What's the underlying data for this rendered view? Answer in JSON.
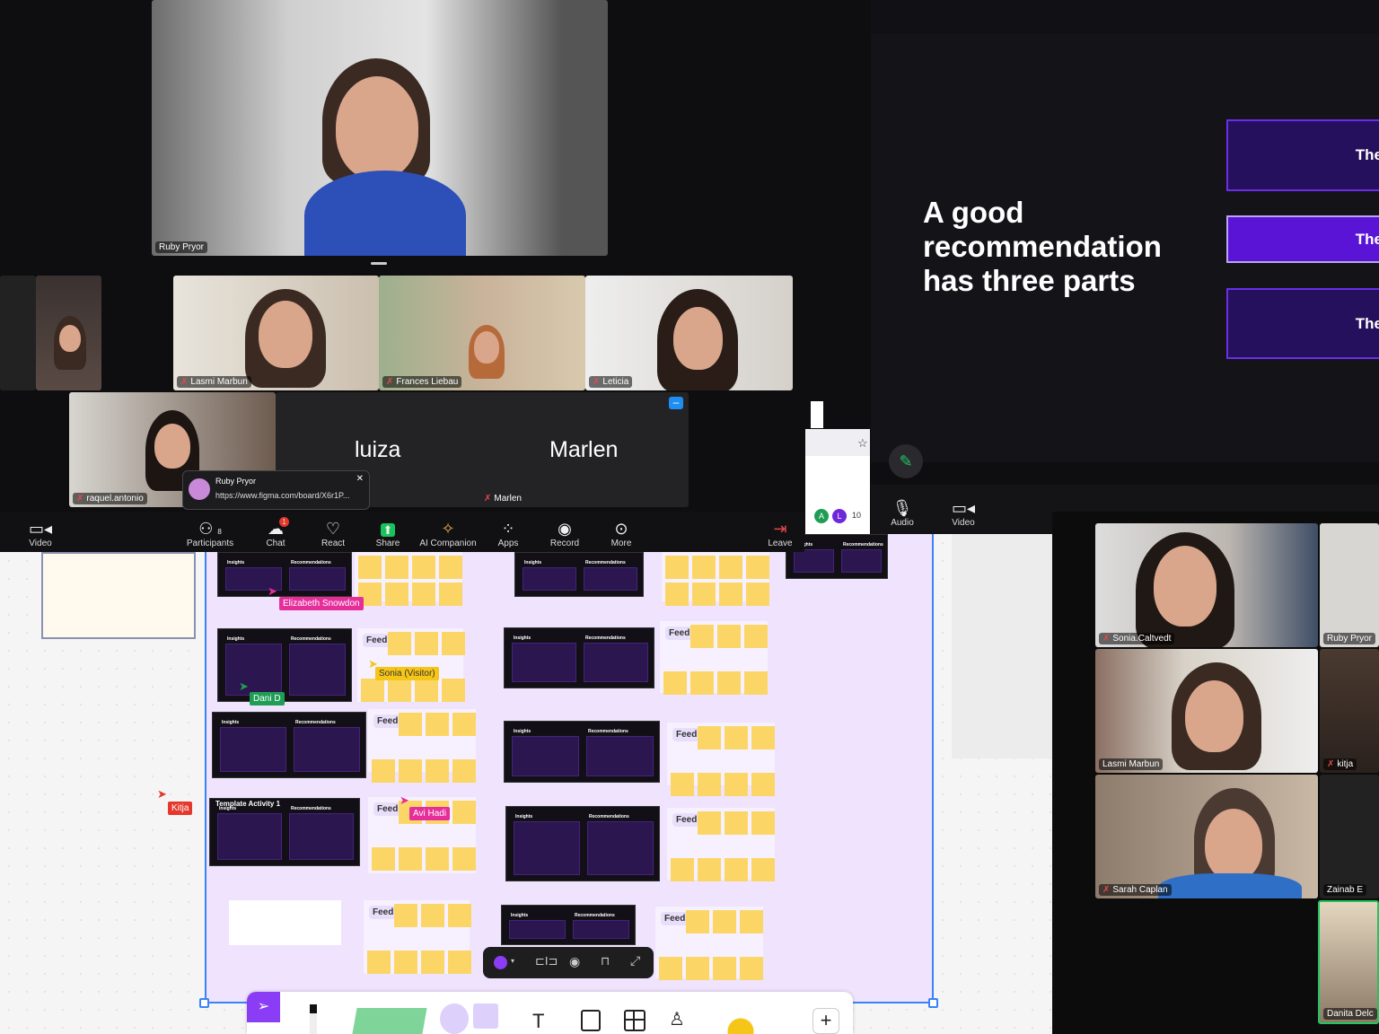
{
  "main_video": {
    "name": "Ruby Pryor"
  },
  "strip": [
    {
      "name": ""
    },
    {
      "name": "Lasmi Marbun"
    },
    {
      "name": "Frances Liebau"
    },
    {
      "name": "Leticia"
    }
  ],
  "row2": {
    "video": "raquel.antonio",
    "luiza": "luiza",
    "marlen": "Marlen",
    "marlen_label": "Marlen"
  },
  "chat_popup": {
    "sender": "Ruby Pryor",
    "message": "https://www.figma.com/board/X6r1P..."
  },
  "toolbar": {
    "video": "Video",
    "participants": "Participants",
    "participants_count": "8",
    "chat": "Chat",
    "chat_badge": "1",
    "react": "React",
    "share": "Share",
    "ai": "AI Companion",
    "apps": "Apps",
    "record": "Record",
    "more": "More",
    "leave": "Leave"
  },
  "browser": {
    "avatars": [
      "A",
      "L"
    ],
    "count": "10"
  },
  "slide": {
    "heading": "A good recommendation has three parts",
    "boxes": [
      "The",
      "The",
      "The"
    ],
    "accent": "#5a14d6"
  },
  "presenter_controls": {
    "audio": "Audio",
    "video": "Video"
  },
  "figjam": {
    "feedback": "Feedback",
    "insights": "Insights",
    "recommendations": "Recommendations",
    "activity_title": "Template Activity 1",
    "cursors": [
      {
        "name": "Elizabeth Snowdon",
        "color": "#e62e9b"
      },
      {
        "name": "Sonia (Visitor)",
        "color": "#f5c518"
      },
      {
        "name": "Dani D",
        "color": "#1f9d55"
      },
      {
        "name": "Kitja",
        "color": "#e5372b"
      },
      {
        "name": "Avi Hadi",
        "color": "#e62e9b"
      }
    ]
  },
  "gallery": [
    {
      "name": "Sonia.Caltvedt"
    },
    {
      "name": "Ruby Pryor"
    },
    {
      "name": "Lasmi Marbun"
    },
    {
      "name": "kitja"
    },
    {
      "name": "Sarah Caplan"
    },
    {
      "name": "Zainab E"
    },
    {
      "name": "Danita Delc"
    }
  ]
}
